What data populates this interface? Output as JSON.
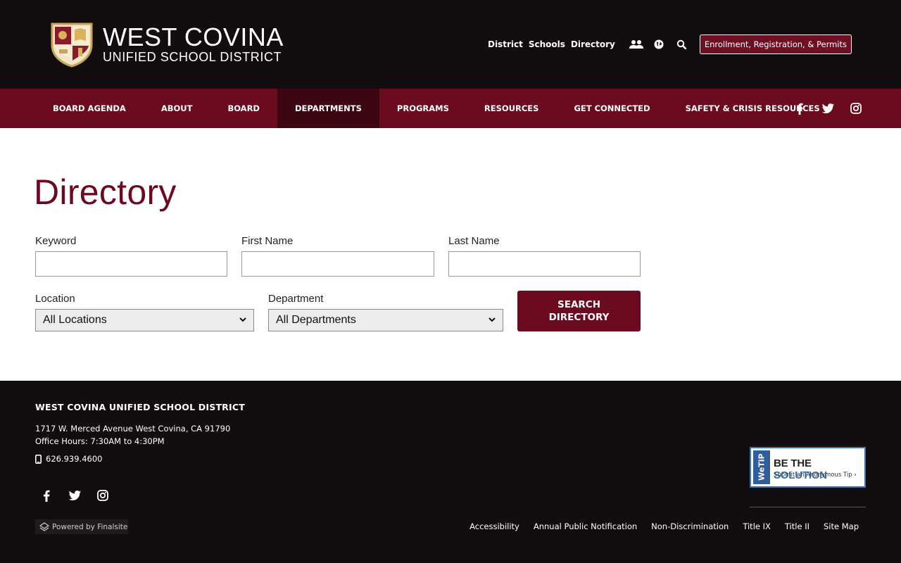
{
  "header": {
    "logo_line1": "WEST COVINA",
    "logo_line2": "UNIFIED SCHOOL DISTRICT",
    "utility_links": [
      "District",
      "Schools",
      "Directory"
    ],
    "enroll_button": "Enrollment, Registration, & Permits",
    "icons": [
      "users-icon",
      "globe-icon",
      "search-icon"
    ]
  },
  "nav": {
    "items": [
      "BOARD AGENDA",
      "ABOUT",
      "BOARD",
      "DEPARTMENTS",
      "PROGRAMS",
      "RESOURCES",
      "GET CONNECTED",
      "SAFETY & CRISIS RESOURCES"
    ],
    "active": "DEPARTMENTS",
    "social_icons": [
      "facebook-icon",
      "twitter-icon",
      "instagram-icon"
    ]
  },
  "main": {
    "title": "Directory",
    "form": {
      "keyword_label": "Keyword",
      "keyword_value": "",
      "first_name_label": "First Name",
      "first_name_value": "",
      "last_name_label": "Last Name",
      "last_name_value": "",
      "location_label": "Location",
      "location_selected": "All Locations",
      "department_label": "Department",
      "department_selected": "All Departments",
      "search_button_line1": "SEARCH",
      "search_button_line2": "DIRECTORY"
    }
  },
  "footer": {
    "title": "WEST COVINA UNIFIED SCHOOL DISTRICT",
    "address": "1717 W. Merced Avenue West Covina, CA 91790",
    "hours": "Office Hours: 7:30AM to 4:30PM",
    "phone": "626.939.4600",
    "powered_by": "Powered by Finalsite",
    "wetip": {
      "side": "WeTiP",
      "headline_part1": "BE THE",
      "headline_part2": "SOLUTION",
      "sub": "Submit an Anonymous Tip ›"
    },
    "links": [
      "Accessibility",
      "Annual Public Notification",
      "Non-Discrimination",
      "Title IX",
      "Title II",
      "Site Map"
    ]
  },
  "colors": {
    "maroon": "#6c0a1f",
    "dark": "#120d0e",
    "nav_active": "#3e0612"
  }
}
